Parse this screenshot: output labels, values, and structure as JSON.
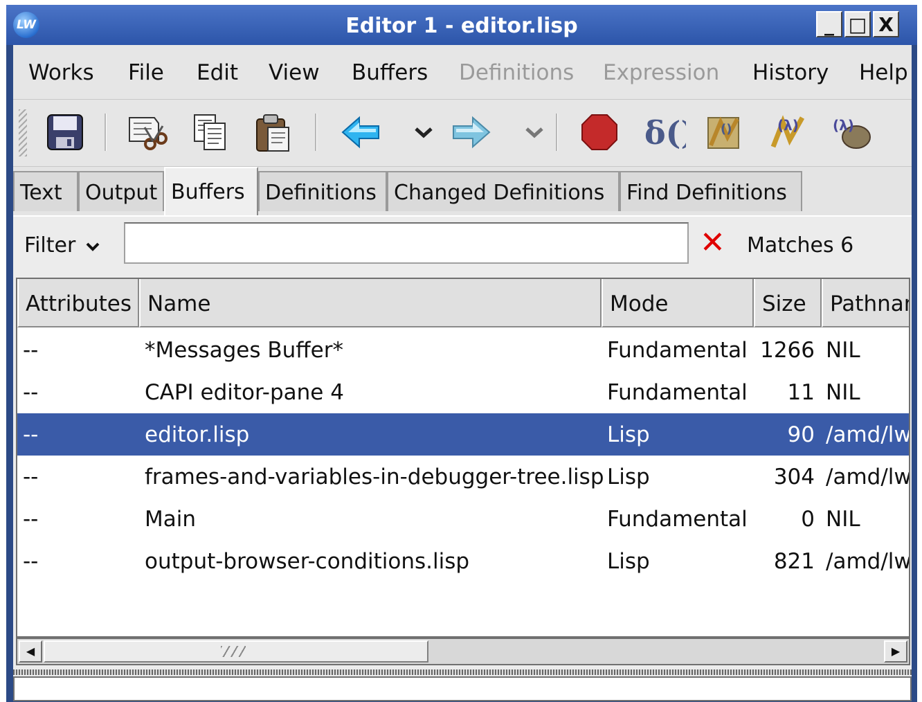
{
  "window": {
    "title": "Editor 1 - editor.lisp",
    "app_icon_text": "LW",
    "controls": {
      "minimize": "_",
      "maximize": "□",
      "close": "X"
    },
    "title_gradient": [
      "#4b74c7",
      "#2c55a9"
    ]
  },
  "menubar": {
    "items": [
      {
        "label": "Works",
        "enabled": true
      },
      {
        "label": "File",
        "enabled": true
      },
      {
        "label": "Edit",
        "enabled": true
      },
      {
        "label": "View",
        "enabled": true
      },
      {
        "label": "Buffers",
        "enabled": true
      },
      {
        "label": "Definitions",
        "enabled": false
      },
      {
        "label": "Expression",
        "enabled": false
      },
      {
        "label": "History",
        "enabled": true
      },
      {
        "label": "Help",
        "enabled": true
      }
    ]
  },
  "toolbar": {
    "buttons": [
      "save-icon",
      "cut-icon",
      "copy-icon",
      "paste-icon",
      "back-arrow-icon",
      "back-history-dropdown-icon",
      "forward-arrow-icon",
      "forward-history-dropdown-icon",
      "stop-icon",
      "lambda-eval-icon",
      "compile-icon",
      "evaluate-icon",
      "debug-icon"
    ]
  },
  "tabs": {
    "items": [
      {
        "label": "Text",
        "active": false
      },
      {
        "label": "Output",
        "active": false
      },
      {
        "label": "Buffers",
        "active": true
      },
      {
        "label": "Definitions",
        "active": false
      },
      {
        "label": "Changed Definitions",
        "active": false
      },
      {
        "label": "Find Definitions",
        "active": false
      }
    ]
  },
  "filter": {
    "label": "Filter",
    "dropdown_icon": "chevron-down-icon",
    "value": "",
    "clear_icon": "✕",
    "matches_text": "Matches 6"
  },
  "buffers_table": {
    "columns": [
      "Attributes",
      "Name",
      "Mode",
      "Size",
      "Pathnar"
    ],
    "rows": [
      {
        "attributes": "--",
        "name": "*Messages Buffer*",
        "mode": "Fundamental",
        "size": "1266",
        "pathname": "NIL",
        "selected": false
      },
      {
        "attributes": "--",
        "name": "CAPI editor-pane 4",
        "mode": "Fundamental",
        "size": "11",
        "pathname": "NIL",
        "selected": false
      },
      {
        "attributes": "--",
        "name": "editor.lisp",
        "mode": "Lisp",
        "size": "90",
        "pathname": "/amd/lw",
        "selected": true
      },
      {
        "attributes": "--",
        "name": "frames-and-variables-in-debugger-tree.lisp",
        "mode": "Lisp",
        "size": "304",
        "pathname": "/amd/lw",
        "selected": false
      },
      {
        "attributes": "--",
        "name": "Main",
        "mode": "Fundamental",
        "size": "0",
        "pathname": "NIL",
        "selected": false
      },
      {
        "attributes": "--",
        "name": "output-browser-conditions.lisp",
        "mode": "Lisp",
        "size": "821",
        "pathname": "/amd/lw",
        "selected": false
      }
    ],
    "selection_color": "#3a5ba8"
  },
  "scrollbar": {
    "left_arrow": "◀",
    "right_arrow": "▶",
    "position": 0.0
  },
  "echo_area": {
    "text": ""
  }
}
